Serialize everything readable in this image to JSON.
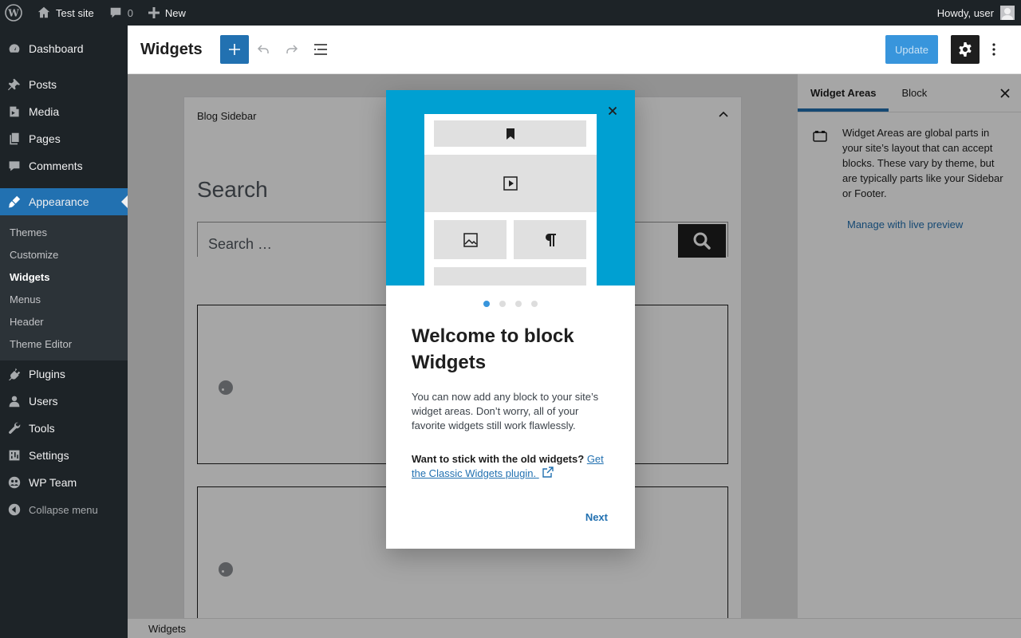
{
  "adminbar": {
    "site_name": "Test site",
    "comments_count": "0",
    "new_label": "New",
    "greeting": "Howdy, user"
  },
  "sidebar": {
    "items": [
      {
        "label": "Dashboard",
        "icon": "dashboard-icon"
      },
      {
        "label": "Posts",
        "icon": "pin-icon"
      },
      {
        "label": "Media",
        "icon": "media-icon"
      },
      {
        "label": "Pages",
        "icon": "pages-icon"
      },
      {
        "label": "Comments",
        "icon": "comment-icon"
      },
      {
        "label": "Appearance",
        "icon": "brush-icon"
      }
    ],
    "submenu": [
      "Themes",
      "Customize",
      "Widgets",
      "Menus",
      "Header",
      "Theme Editor"
    ],
    "items_after": [
      {
        "label": "Plugins",
        "icon": "plugin-icon"
      },
      {
        "label": "Users",
        "icon": "user-icon"
      },
      {
        "label": "Tools",
        "icon": "wrench-icon"
      },
      {
        "label": "Settings",
        "icon": "settings-icon"
      },
      {
        "label": "WP Team",
        "icon": "team-icon"
      }
    ],
    "collapse_label": "Collapse menu"
  },
  "header": {
    "title": "Widgets",
    "update_label": "Update"
  },
  "canvas": {
    "area_title": "Blog Sidebar",
    "search_heading": "Search",
    "search_placeholder": "Search …"
  },
  "inspector": {
    "tabs": [
      "Widget Areas",
      "Block"
    ],
    "description": "Widget Areas are global parts in your site’s layout that can accept blocks. These vary by theme, but are typically parts like your Sidebar or Footer.",
    "live_preview_label": "Manage with live preview"
  },
  "footer": {
    "breadcrumb": "Widgets"
  },
  "modal": {
    "heading": "Welcome to block Widgets",
    "text": "You can now add any block to your site’s widget areas. Don’t worry, all of your favorite widgets still work flawlessly.",
    "classic_prompt": "Want to stick with the old widgets?",
    "classic_link": "Get the Classic Widgets plugin.",
    "next_label": "Next",
    "pages_total": 4,
    "page_current": 1
  },
  "colors": {
    "admin_dark": "#1d2327",
    "accent": "#2271b1",
    "hero": "#00a0d2"
  }
}
